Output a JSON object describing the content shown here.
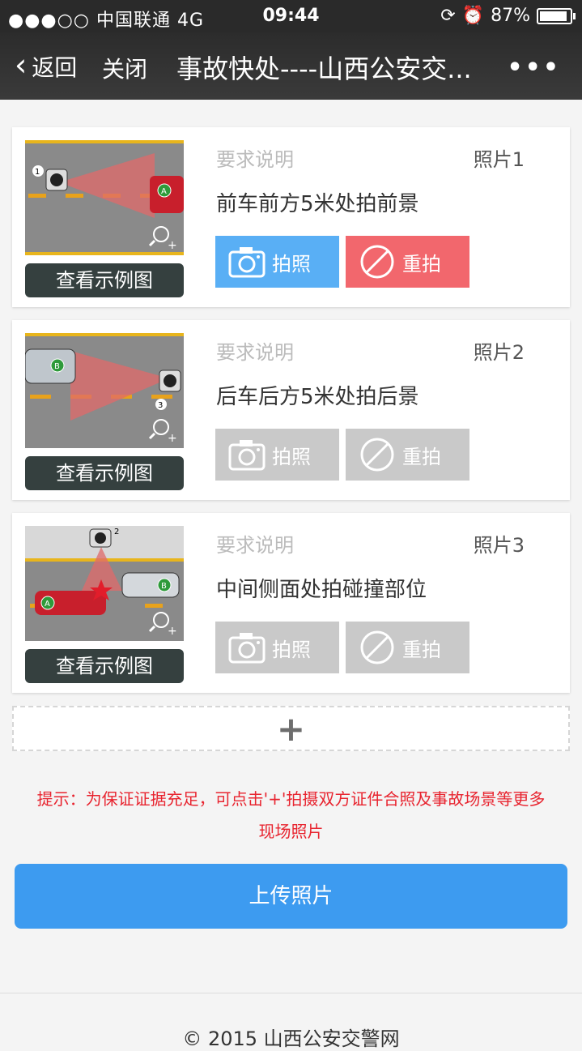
{
  "status": {
    "carrier": "●●●○○ 中国联通  4G",
    "time": "09:44",
    "battery": "87%"
  },
  "nav": {
    "back": "返回",
    "close": "关闭",
    "title": "事故快处----山西公安交...",
    "more": "•••"
  },
  "cards": [
    {
      "req_label": "要求说明",
      "photo_no": "照片1",
      "req_text": "前车前方5米处拍前景",
      "view": "查看示例图",
      "take": "拍照",
      "retake": "重拍"
    },
    {
      "req_label": "要求说明",
      "photo_no": "照片2",
      "req_text": "后车后方5米处拍后景",
      "view": "查看示例图",
      "take": "拍照",
      "retake": "重拍"
    },
    {
      "req_label": "要求说明",
      "photo_no": "照片3",
      "req_text": "中间侧面处拍碰撞部位",
      "view": "查看示例图",
      "take": "拍照",
      "retake": "重拍"
    }
  ],
  "add": "+",
  "tip_line1": "提示：为保证证据充足，可点击'+'拍摄双方证件合照及事故场景等更多",
  "tip_line2": "现场照片",
  "upload": "上传照片",
  "footer": "© 2015 山西公安交警网",
  "colors": {
    "take_active": "#59aff5",
    "retake_active": "#f2676d",
    "disabled": "#c9c9c9",
    "upload": "#3d9bf0",
    "tip": "#e8242f"
  }
}
